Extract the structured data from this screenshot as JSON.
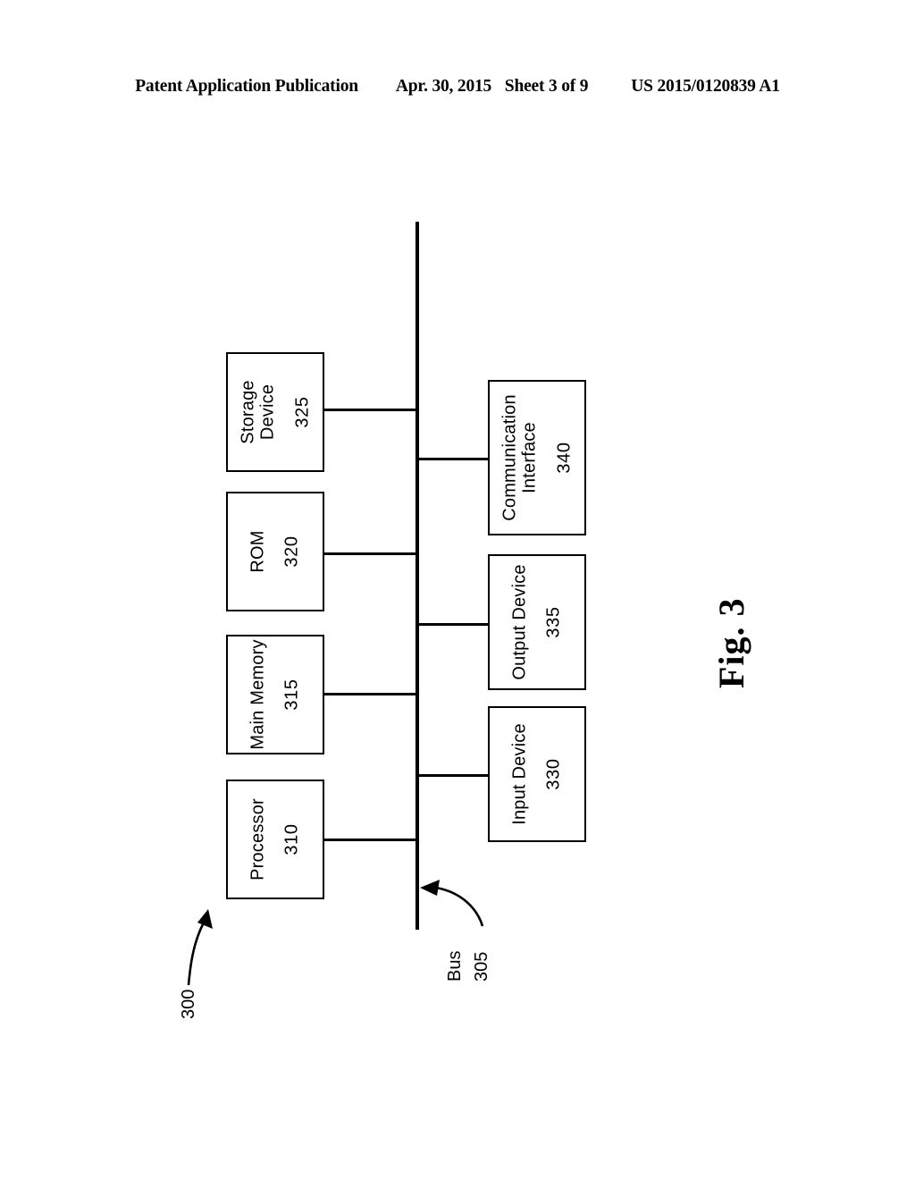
{
  "header": {
    "publication": "Patent Application Publication",
    "date": "Apr. 30, 2015",
    "sheet": "Sheet 3 of 9",
    "doc_number": "US 2015/0120839 A1"
  },
  "figure": {
    "caption": "Fig. 3",
    "system_ref": "300",
    "bus": {
      "label": "Bus",
      "ref": "305"
    },
    "left_nodes": [
      {
        "title_line1": "Storage",
        "title_line2": "Device",
        "ref": "325"
      },
      {
        "title_line1": "ROM",
        "title_line2": "",
        "ref": "320"
      },
      {
        "title_line1": "Main Memory",
        "title_line2": "",
        "ref": "315"
      },
      {
        "title_line1": "Processor",
        "title_line2": "",
        "ref": "310"
      }
    ],
    "right_nodes": [
      {
        "title_line1": "Communication",
        "title_line2": "Interface",
        "ref": "340"
      },
      {
        "title_line1": "Output Device",
        "title_line2": "",
        "ref": "335"
      },
      {
        "title_line1": "Input Device",
        "title_line2": "",
        "ref": "330"
      }
    ]
  },
  "colors": {
    "ink": "#000000",
    "paper": "#ffffff"
  }
}
